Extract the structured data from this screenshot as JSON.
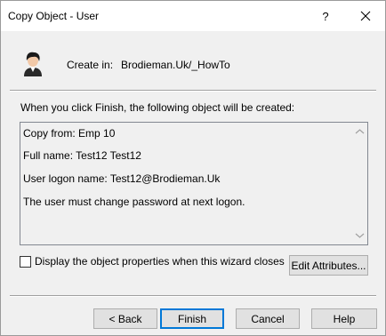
{
  "window": {
    "title": "Copy Object - User",
    "help_label": "?"
  },
  "header": {
    "create_in_label": "Create in:",
    "create_in_value": "Brodieman.Uk/_HowTo"
  },
  "intro_text": "When you click Finish, the following object will be created:",
  "summary": {
    "lines": [
      "Copy from: Emp 10",
      "Full name: Test12 Test12",
      "User logon name: Test12@Brodieman.Uk",
      "The user must change password at next logon."
    ]
  },
  "options": {
    "display_props_label": "Display the object properties when this wizard closes",
    "display_props_checked": false,
    "edit_attributes_label": "Edit Attributes..."
  },
  "buttons": {
    "back": "< Back",
    "finish": "Finish",
    "cancel": "Cancel",
    "help": "Help"
  },
  "icons": {
    "user": "user-icon",
    "close": "close-icon",
    "scroll_up": "chevron-up-icon",
    "scroll_down": "chevron-down-icon"
  },
  "colors": {
    "default_button_border": "#0078d7",
    "dialog_background": "#f0f0f0"
  }
}
